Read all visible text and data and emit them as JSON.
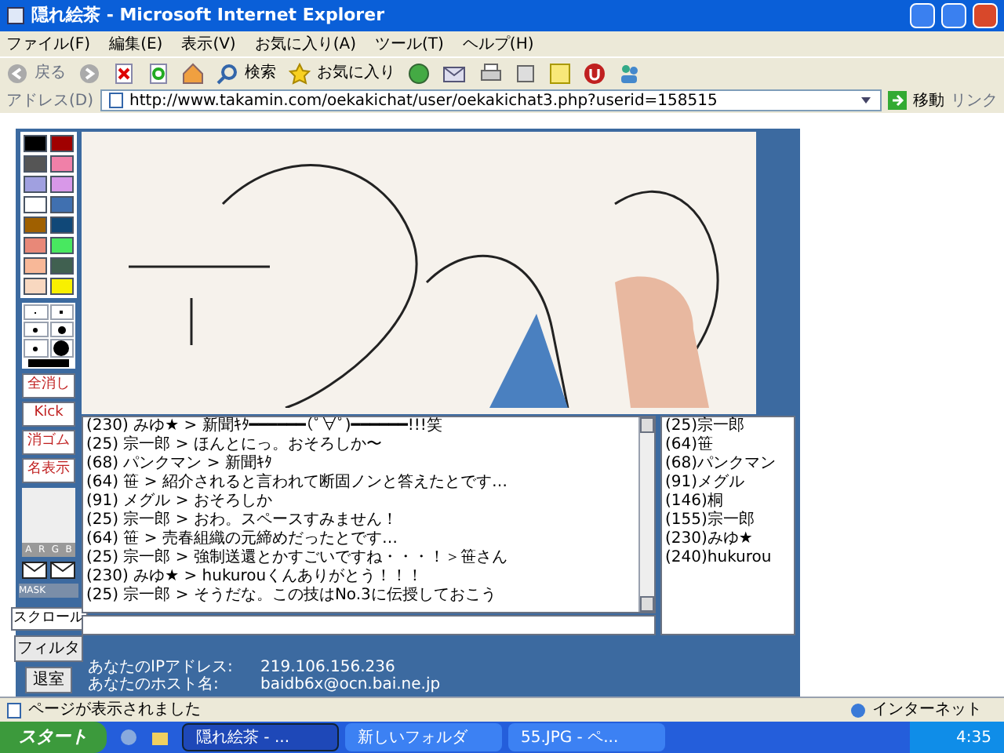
{
  "window": {
    "title": "隠れ絵茶 - Microsoft Internet Explorer"
  },
  "menu": [
    "ファイル(F)",
    "編集(E)",
    "表示(V)",
    "お気に入り(A)",
    "ツール(T)",
    "ヘルプ(H)"
  ],
  "toolbar": {
    "back": "戻る",
    "search": "検索",
    "favorites": "お気に入り"
  },
  "address_bar": {
    "label": "アドレス(D)",
    "url": "http://www.takamin.com/oekakichat/user/oekakichat3.php?userid=158515",
    "go": "移動",
    "links": "リンク"
  },
  "palette": [
    {
      "color": "#000000"
    },
    {
      "color": "#a00000"
    },
    {
      "color": "#555555"
    },
    {
      "color": "#f080a8"
    },
    {
      "color": "#a0a0e0"
    },
    {
      "color": "#d898e8"
    },
    {
      "color": "#ffffff"
    },
    {
      "color": "#4070b0"
    },
    {
      "color": "#a06000"
    },
    {
      "color": "#104878"
    },
    {
      "color": "#e88878"
    },
    {
      "color": "#48e860"
    },
    {
      "color": "#f8b898"
    },
    {
      "color": "#406050"
    },
    {
      "color": "#f8d8c0"
    },
    {
      "color": "#f8f000"
    }
  ],
  "tool_buttons": [
    "全消し",
    "Kick",
    "消ゴム",
    "名表示"
  ],
  "slider_labels": [
    "A",
    "R",
    "G",
    "B"
  ],
  "mask_label": "MASK",
  "scroll_button": "スクロール",
  "filter_button": "フィルタ",
  "exit_button": "退室",
  "chat_log": [
    "(230) みゆ★ > 新聞ｷﾀ━━━━━━(ﾟ∀ﾟ)━━━━━━!!!笑",
    "(25) 宗一郎 > ほんとにっ。おそろしか〜",
    "(68) パンクマン > 新聞ｷﾀ",
    "(64) 笹 > 紹介されると言われて断固ノンと答えたとです…",
    "(91) メグル > おそろしか",
    "(25) 宗一郎 > おわ。スペースすみません！",
    "(64) 笹 > 売春組織の元締めだったとです…",
    "(25) 宗一郎 > 強制送還とかすごいですね・・・！＞笹さん",
    "(230) みゆ★ > hukurouくんありがとう！！！",
    "(25) 宗一郎 > そうだな。この技はNo.3に伝授しておこう"
  ],
  "users": [
    "(25)宗一郎",
    "(64)笹",
    "(68)パンクマン",
    "(91)メグル",
    "(146)桐",
    "(155)宗一郎",
    "(230)みゆ★",
    "(240)hukurou"
  ],
  "info": [
    {
      "label": "あなたのIPアドレス:",
      "value": "219.106.156.236"
    },
    {
      "label": "あなたのホスト名:",
      "value": "baidb6x@ocn.bai.ne.jp"
    }
  ],
  "status_bar": {
    "message": "ページが表示されました",
    "zone": "インターネット"
  },
  "taskbar": {
    "start": "スタート",
    "tasks": [
      {
        "label": "隠れ絵茶 - ...",
        "selected": true
      },
      {
        "label": "新しいフォルダ",
        "selected": false
      },
      {
        "label": "55.JPG - ペ...",
        "selected": false
      }
    ],
    "clock": "4:35"
  }
}
